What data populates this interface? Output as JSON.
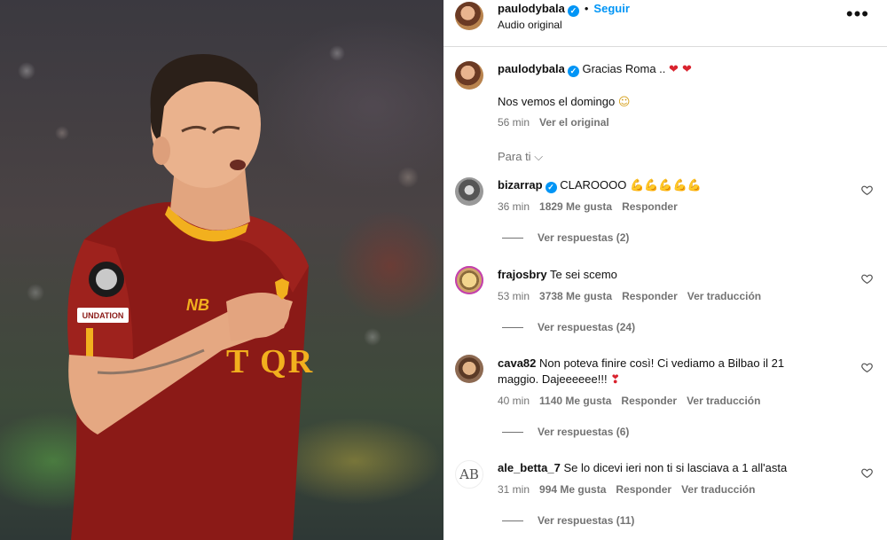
{
  "post": {
    "author": "paulodybala",
    "follow_label": "Seguir",
    "audio": "Audio original",
    "more_icon": "more-horizontal-icon"
  },
  "caption": {
    "username": "paulodybala",
    "line1": "Gracias Roma .. ",
    "line1_emoji": "❤ ❤",
    "line2": "Nos vemos el domingo ",
    "line2_emoji": "☺",
    "time": "56 min",
    "see_original": "Ver el original"
  },
  "filter": {
    "label": "Para ti",
    "chevron": "⌵"
  },
  "comments": [
    {
      "username": "bizarrap",
      "verified": true,
      "text": "CLAROOOO ",
      "emoji": "💪💪💪💪💪",
      "time": "36 min",
      "likes": "1829 Me gusta",
      "reply": "Responder",
      "translate": "",
      "replies": "Ver respuestas (2)"
    },
    {
      "username": "frajosbry",
      "verified": false,
      "text": "Te sei scemo",
      "emoji": "",
      "time": "53 min",
      "likes": "3738 Me gusta",
      "reply": "Responder",
      "translate": "Ver traducción",
      "replies": "Ver respuestas (24)"
    },
    {
      "username": "cava82",
      "verified": false,
      "text": "Non poteva finire così! Ci vediamo a Bilbao il 21",
      "text2": "maggio. Dajeeeeee!!! ",
      "emoji": "❣",
      "time": "40 min",
      "likes": "1140 Me gusta",
      "reply": "Responder",
      "translate": "Ver traducción",
      "replies": "Ver respuestas (6)"
    },
    {
      "username": "ale_betta_7",
      "verified": false,
      "avatar_text": "AB",
      "text": "Se lo dicevi ieri non ti si lasciava a 1 all'asta",
      "emoji": "",
      "time": "31 min",
      "likes": "994 Me gusta",
      "reply": "Responder",
      "translate": "Ver traducción",
      "replies": "Ver respuestas (11)"
    }
  ],
  "colors": {
    "link_blue": "#0095f6",
    "muted": "#737373",
    "jersey": "#8b1a17",
    "jersey_trim": "#f2b01e"
  }
}
